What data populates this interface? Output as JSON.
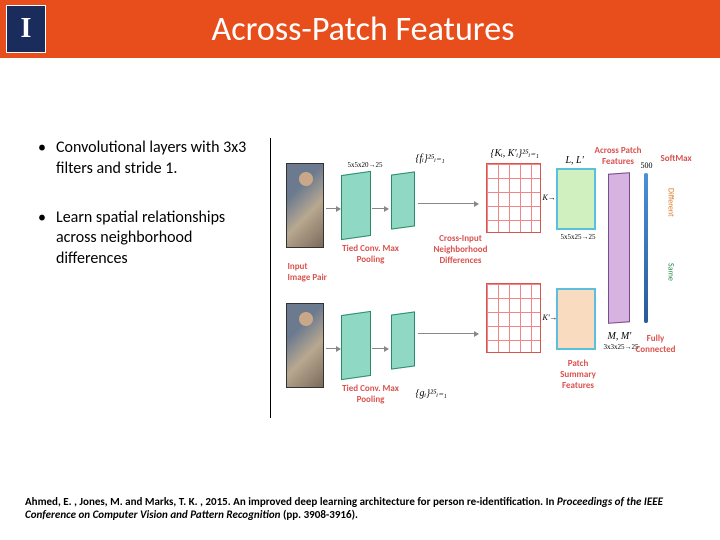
{
  "header": {
    "logo_letter": "I",
    "title": "Across-Patch Features"
  },
  "bullets": [
    "Convolutional layers with 3x3 filters and stride 1.",
    "Learn spatial relationships across neighborhood differences"
  ],
  "diagram": {
    "input_label": "Input Image Pair",
    "tied_label": "Tied Conv. Max Pooling",
    "diff_label": "Cross-Input Neighborhood Differences",
    "patch_sum_label": "Patch Summary Features",
    "across_label": "Across Patch Features",
    "fc_label": "Fully Connected",
    "softmax_label": "SoftMax",
    "out_same": "Same",
    "out_diff": "Different",
    "dim_500": "500",
    "dim_25": "25",
    "f_i": "{fᵢ}²⁵ᵢ₌₁",
    "g_i": "{gᵢ}²⁵ᵢ₌₁",
    "K": "{Kᵢ, K'ᵢ}²⁵ᵢ₌₁",
    "KL": "K→L",
    "KLp": "K'→L'",
    "L": "L, L'",
    "M": "M, M'",
    "conv_spec1": "5x5x25→25",
    "conv_spec2": "3x3x25→25",
    "conv_dims": "5x5x20→25"
  },
  "citation": {
    "authors": "Ahmed, E. , Jones, M. and Marks, T. K. , 2015. An improved deep learning architecture for person re-identification. In ",
    "venue": "Proceedings of the IEEE Conference on Computer Vision and Pattern Recognition",
    "pages": " (pp. 3908-3916)."
  }
}
